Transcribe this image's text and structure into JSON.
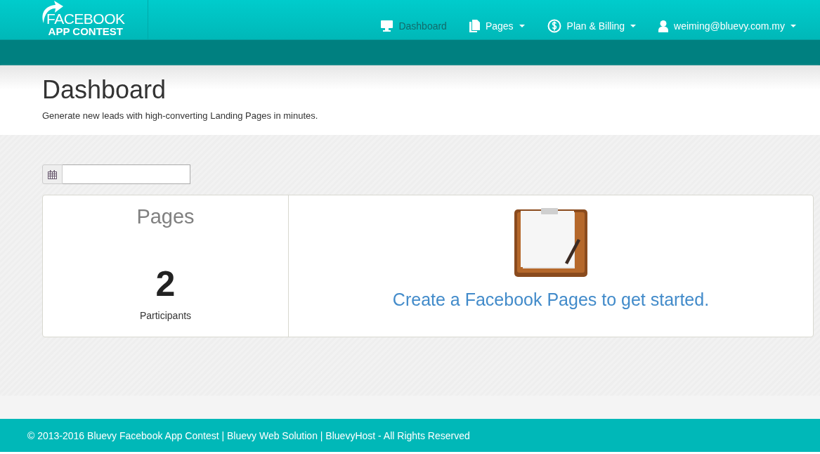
{
  "logo": {
    "line_1": "FACEBOOK",
    "line_2": "APP CONTEST"
  },
  "nav": [
    {
      "kind": "dashboard",
      "label": "Dashboard",
      "selected": true,
      "dropdown": false
    },
    {
      "kind": "pages",
      "label": "Pages",
      "selected": false,
      "dropdown": true
    },
    {
      "kind": "billing",
      "label": "Plan & Billing",
      "selected": false,
      "dropdown": true
    },
    {
      "kind": "user",
      "label": "weiming@bluevy.com.my",
      "selected": false,
      "dropdown": true
    }
  ],
  "page_header": {
    "title": "Dashboard",
    "subtitle": "Generate new leads with high-converting Landing Pages in minutes."
  },
  "stat_card": {
    "title": "Pages",
    "value": "2",
    "caption": "Participants"
  },
  "empty_state": {
    "message": "Create a Facebook Pages to get started."
  },
  "footer": "© 2013-2016 Bluevy Facebook App Contest | Bluevy Web Solution | BluevyHost - All Rights Reserved"
}
